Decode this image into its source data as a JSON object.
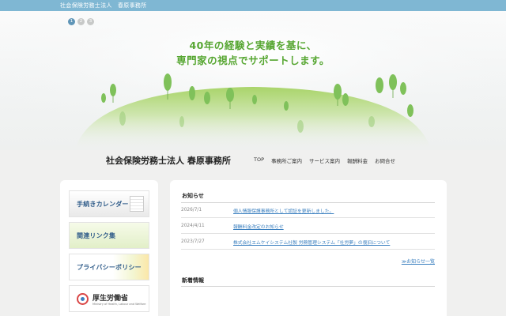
{
  "header": {
    "office_name": "社会保険労務士法人　春原事務所"
  },
  "hero": {
    "slides": [
      "1",
      "2",
      "3"
    ],
    "active_slide": 1,
    "tagline_1": "40年の経験と実績を基に、",
    "tagline_2": "専門家の視点でサポートします。"
  },
  "site": {
    "title": "社会保険労務士法人 春原事務所"
  },
  "nav": [
    "TOP",
    "事務所ご案内",
    "サービス案内",
    "報酬料金",
    "お問合せ"
  ],
  "sidebar": {
    "calendar": "手続きカレンダー",
    "links": "関連リンク集",
    "privacy": "プライバシーポリシー",
    "mhlw_jp": "厚生労働省",
    "mhlw_en": "Ministry of Health, Labour and Welfare"
  },
  "news": {
    "title": "お知らせ",
    "items": [
      {
        "date": "2026/7/1",
        "text": "個人情報保護事務所として認証を更新しました。"
      },
      {
        "date": "2024/4/11",
        "text": "報酬料金改定のお知らせ"
      },
      {
        "date": "2023/7/27",
        "text": "株式会社エムケイシステム社製 労務管理システム「社労夢」の復旧について"
      }
    ],
    "more": "≫お知らせ一覧"
  },
  "updates": {
    "title": "新着情報"
  },
  "colors": {
    "accent_blue": "#7fb7d3",
    "tagline_green": "#56a631",
    "link_blue": "#3a7fbf"
  }
}
